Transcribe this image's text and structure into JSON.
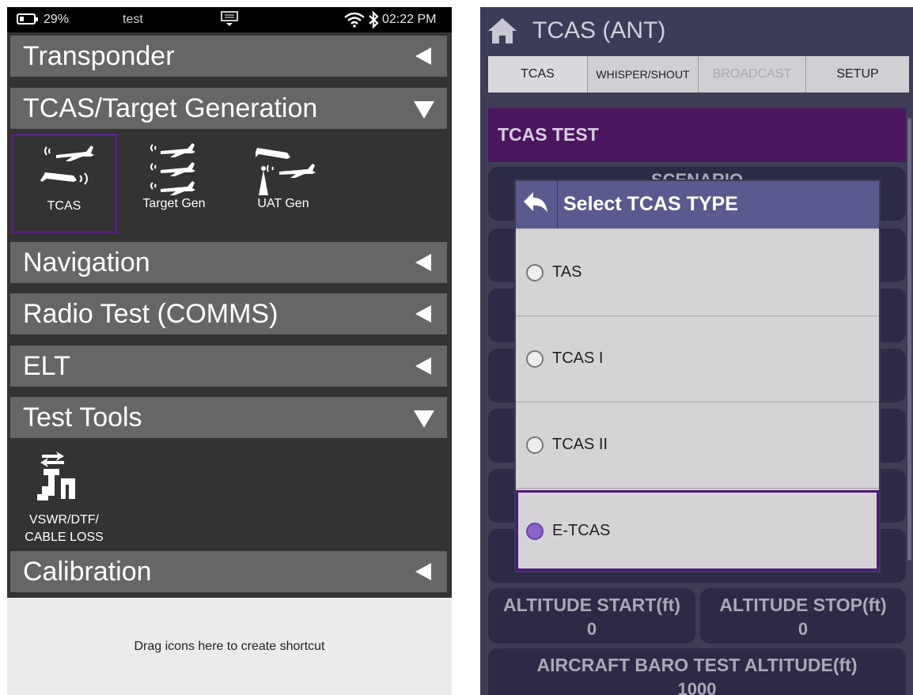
{
  "left": {
    "status": {
      "battery": "29%",
      "name": "test",
      "time": "02:22 PM"
    },
    "sections": [
      {
        "label": "Transponder",
        "state": "collapsed"
      },
      {
        "label": "TCAS/Target Generation",
        "state": "expanded"
      },
      {
        "label": "Navigation",
        "state": "collapsed"
      },
      {
        "label": "Radio Test (COMMS)",
        "state": "collapsed"
      },
      {
        "label": "ELT",
        "state": "collapsed"
      },
      {
        "label": "Test Tools",
        "state": "expanded"
      },
      {
        "label": "Calibration",
        "state": "collapsed"
      }
    ],
    "tcas_tiles": [
      {
        "label": "TCAS",
        "icon": "tcas-icon",
        "selected": true
      },
      {
        "label": "Target Gen",
        "icon": "target-gen-icon"
      },
      {
        "label": "UAT Gen",
        "icon": "uat-gen-icon"
      }
    ],
    "tools_tile": {
      "label1": "VSWR/DTF/",
      "label2": "CABLE LOSS",
      "icon": "vswr-icon"
    },
    "dropzone": "Drag icons here to create shortcut"
  },
  "right": {
    "title": "TCAS (ANT)",
    "tabs": [
      "TCAS",
      "WHISPER/SHOUT",
      "BROADCAST",
      "SETUP"
    ],
    "header": "TCAS TEST",
    "scenario_label": "SCENARIO",
    "fields": {
      "alt_start_label": "ALTITUDE START(ft)",
      "alt_start_value": "0",
      "alt_stop_label": "ALTITUDE STOP(ft)",
      "alt_stop_value": "0",
      "baro_label": "AIRCRAFT BARO TEST ALTITUDE(ft)",
      "baro_value": "1000"
    },
    "dialog": {
      "title": "Select TCAS TYPE",
      "options": [
        "TAS",
        "TCAS I",
        "TCAS II",
        "E-TCAS"
      ],
      "selected": "E-TCAS"
    },
    "colors": {
      "accent": "#4b1560",
      "dialog_head": "#5b5a8e"
    }
  }
}
